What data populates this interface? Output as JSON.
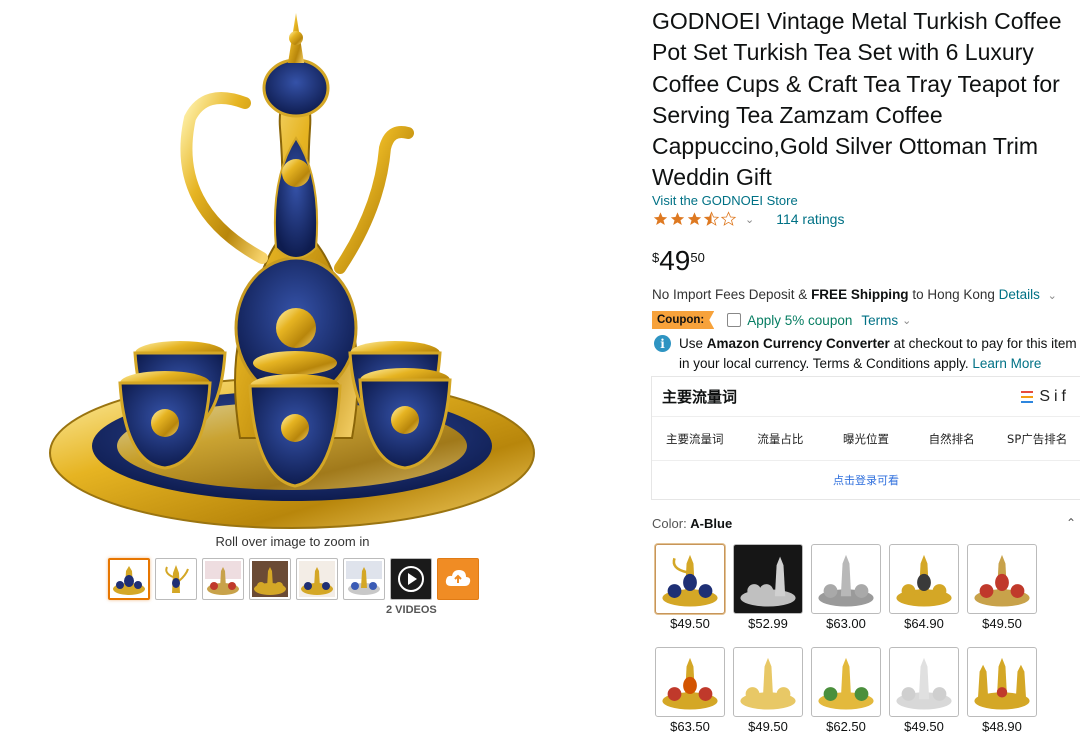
{
  "gallery": {
    "zoom_hint": "Roll over image to zoom in",
    "videos_label": "2 VIDEOS",
    "thumbnails": [
      "gold-blue-set",
      "teapot-gold",
      "red-set",
      "brown-set",
      "blue-set",
      "silver-set",
      "play-icon",
      "upload-icon"
    ]
  },
  "product": {
    "title": "GODNOEI Vintage Metal Turkish Coffee Pot Set Turkish Tea Set with 6 Luxury Coffee Cups & Craft Tea Tray Teapot for Serving Tea Zamzam Coffee Cappuccino,Gold Silver Ottoman Trim Weddin Gift",
    "store_link": "Visit the GODNOEI Store",
    "rating": 3.5,
    "ratings_count": "114 ratings",
    "price": {
      "currency": "$",
      "whole": "49",
      "fraction": "50"
    }
  },
  "shipping": {
    "prefix": "No Import Fees Deposit & ",
    "free": "FREE Shipping",
    "to": " to Hong Kong ",
    "details": "Details"
  },
  "coupon": {
    "badge": "Coupon:",
    "text": "Apply 5% coupon",
    "terms": "Terms"
  },
  "converter": {
    "use": "Use ",
    "bold": "Amazon Currency Converter",
    "rest": " at checkout to pay for this item in your local currency. Terms & Conditions apply. ",
    "learn_more": "Learn More"
  },
  "sif": {
    "title": "主要流量词",
    "brand": "Sif",
    "columns": [
      "主要流量词",
      "流量占比",
      "曝光位置",
      "自然排名",
      "SP广告排名"
    ],
    "login": "点击登录可看",
    "logo_colors": [
      "#e74c3c",
      "#f39c12",
      "#2e86de"
    ]
  },
  "color": {
    "label": "Color: ",
    "selected": "A-Blue",
    "options": [
      {
        "price": "$49.50",
        "variant": "blue"
      },
      {
        "price": "$52.99",
        "variant": "silver-dark"
      },
      {
        "price": "$63.00",
        "variant": "silver"
      },
      {
        "price": "$64.90",
        "variant": "gold-blue"
      },
      {
        "price": "$49.50",
        "variant": "red"
      },
      {
        "price": "$63.50",
        "variant": "red-gold"
      },
      {
        "price": "$49.50",
        "variant": "gold"
      },
      {
        "price": "$62.50",
        "variant": "gold-green"
      },
      {
        "price": "$49.50",
        "variant": "white-silver"
      },
      {
        "price": "$48.90",
        "variant": "gold-red"
      }
    ]
  },
  "colors": {
    "link": "#007185",
    "coupon_badge": "#f7a23b",
    "coupon_text": "#067d62",
    "star": "#de7921",
    "selected_thumb": "#e77600"
  }
}
